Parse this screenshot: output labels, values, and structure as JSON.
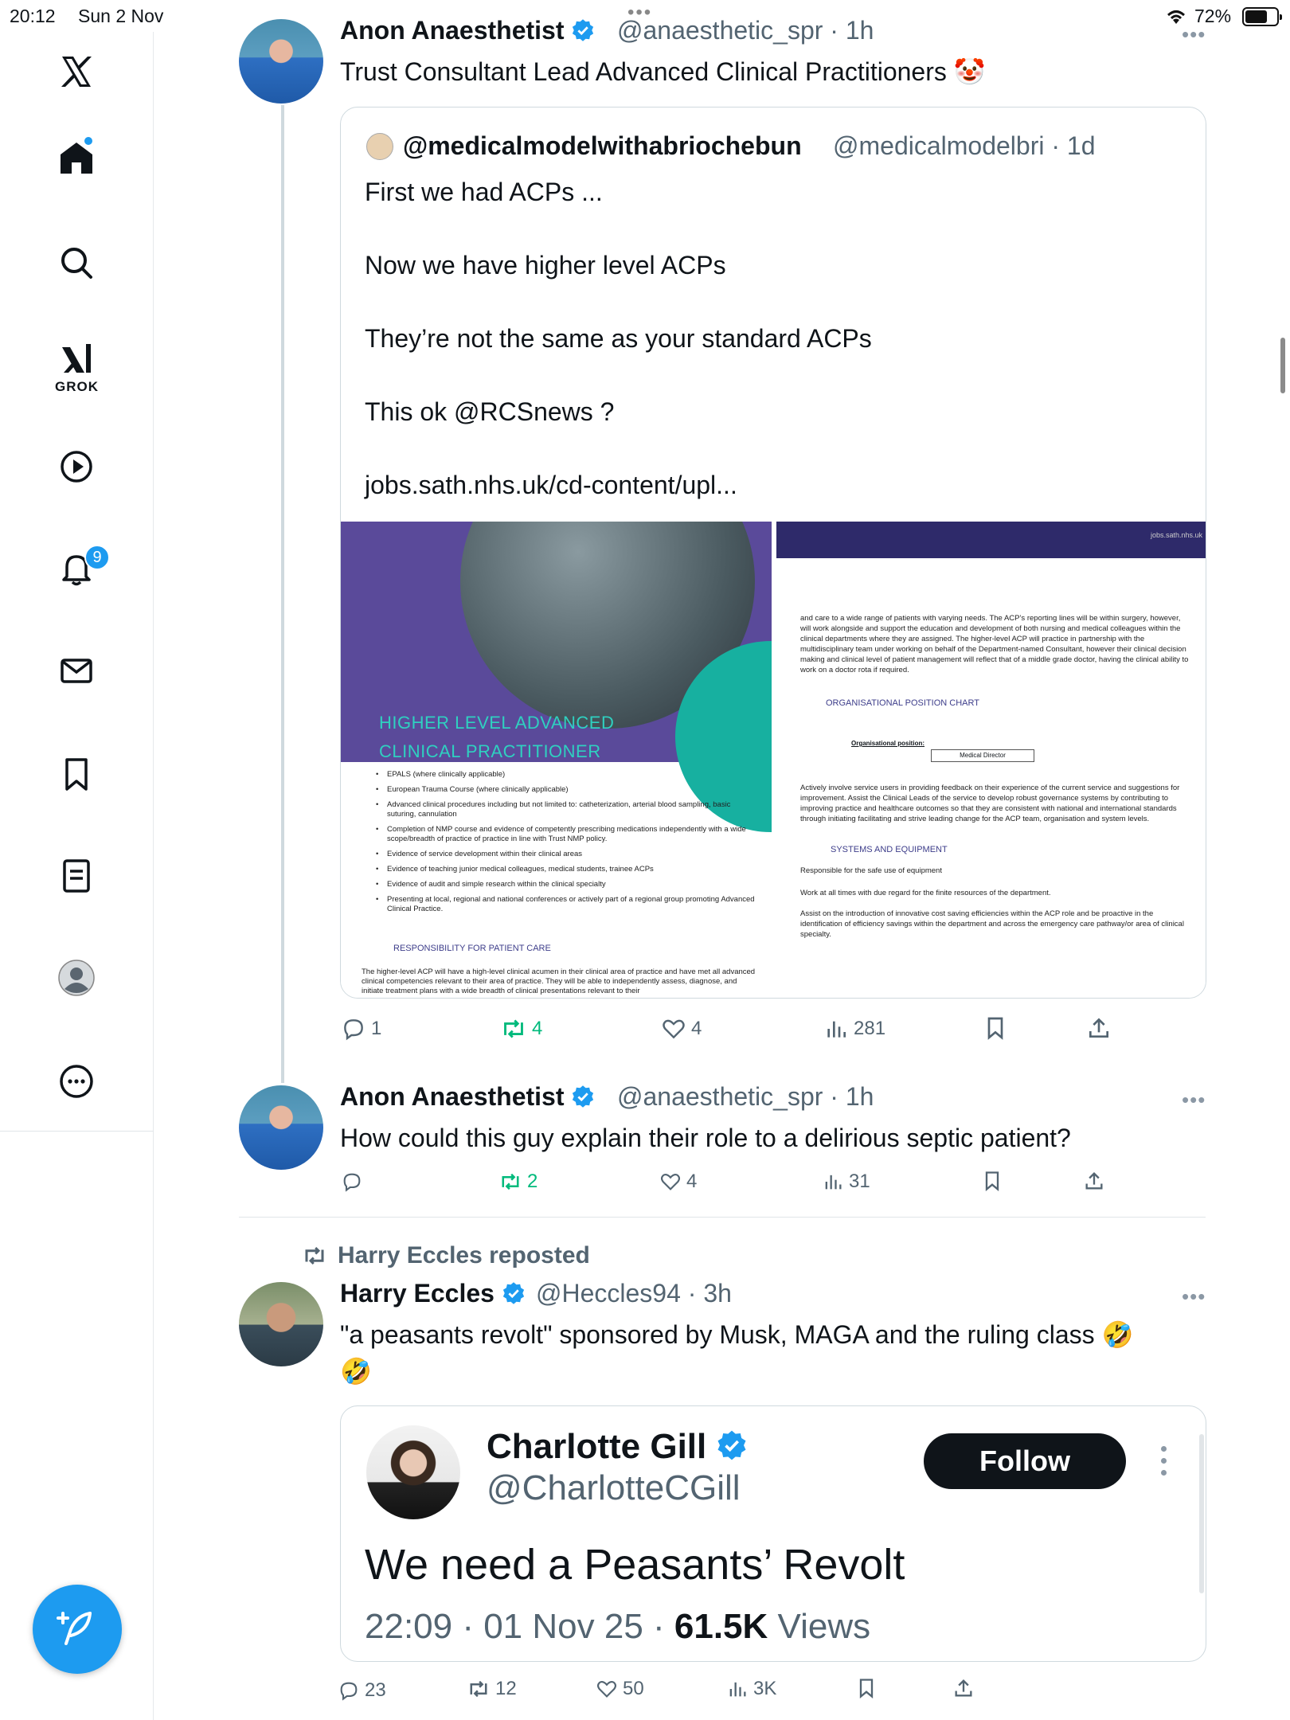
{
  "status_bar": {
    "time": "20:12",
    "date": "Sun 2 Nov",
    "battery": "72%",
    "battery_level": 0.72
  },
  "sidebar": {
    "items": [
      {
        "icon": "x-logo-icon"
      },
      {
        "icon": "home-icon"
      },
      {
        "icon": "search-icon"
      },
      {
        "icon": "grok-icon",
        "label": "GROK"
      },
      {
        "icon": "play-icon"
      },
      {
        "icon": "bell-icon",
        "badge": "9"
      },
      {
        "icon": "mail-icon"
      },
      {
        "icon": "bookmark-icon"
      },
      {
        "icon": "list-icon"
      },
      {
        "icon": "profile-icon"
      },
      {
        "icon": "more-icon"
      }
    ],
    "compose_icon": "compose-icon"
  },
  "colors": {
    "accent": "#1d9bf0",
    "repost_green": "#00ba7c",
    "muted": "#536471"
  },
  "post1": {
    "name": "Anon Anaesthetist",
    "handle": "@anaesthetic_spr",
    "time": "· 1h",
    "text": "Trust Consultant Lead Advanced Clinical Practitioners 🤡",
    "quote": {
      "name": "@medicalmodelwithabriochebun",
      "handle": "@medicalmodelbri · 1d",
      "lines": [
        "First we had ACPs ...",
        "Now we have higher level ACPs",
        "They’re not the same as your standard ACPs",
        "This ok @RCSnews ?",
        "jobs.sath.nhs.uk/cd-content/upl..."
      ],
      "image_left": {
        "title_line1": "HIGHER LEVEL ADVANCED",
        "title_line2": "CLINICAL PRACTITIONER",
        "bullets": [
          "EPALS (where clinically applicable)",
          "European Trauma Course (where clinically applicable)",
          "Advanced clinical procedures including but not limited to: catheterization, arterial blood sampling, basic suturing, cannulation",
          "Completion of NMP course and evidence of competently prescribing medications independently with a wide scope/breadth of practice of practice in line with Trust NMP policy.",
          "Evidence of service development within their clinical areas",
          "Evidence of teaching junior medical colleagues, medical students, trainee ACPs",
          "Evidence of audit and simple research within the clinical specialty",
          "Presenting at local, regional and national conferences or actively part of a regional group promoting Advanced Clinical Practice."
        ],
        "resp_heading": "RESPONSIBILITY FOR PATIENT CARE",
        "resp_body": "The higher-level ACP will have a high-level clinical acumen in their clinical area of practice and have met all advanced clinical competencies relevant to their area of practice. They will be able to independently assess, diagnose, and initiate treatment plans with a wide breadth of clinical presentations relevant to their"
      },
      "image_right": {
        "band_text": "jobs.sath.nhs.uk",
        "para1": "and care to a wide range of patients with varying needs. The ACP’s reporting lines will be within surgery, however, will work alongside and support the education and development of both nursing and medical colleagues within the clinical departments where they are assigned. The higher-level ACP will practice in partnership with the multidisciplinary team under working on behalf of the Department-named Consultant, however their clinical decision making and clinical level of patient management will reflect that of a middle grade doctor, having the clinical ability to work on a doctor rota if required.",
        "heading1": "ORGANISATIONAL POSITION CHART",
        "org_label": "Organisational position:",
        "org_box": "Medical Director",
        "para2": "Actively involve service users in providing feedback on their experience of the current service and suggestions for improvement. Assist the Clinical Leads of the service to develop robust governance systems by contributing to improving practice and healthcare outcomes so that they are consistent with national and international standards through initiating facilitating and strive leading change for the ACP team, organisation and system levels.",
        "heading2": "SYSTEMS AND EQUIPMENT",
        "para3": "Responsible for the safe use of equipment",
        "para4": "Work at all times with due regard for the finite resources of the department.",
        "para5": "Assist on the introduction of innovative cost saving efficiencies within the ACP role and be proactive in the identification of efficiency savings within the department and across the emergency care pathway/or area of clinical specialty."
      }
    },
    "stats": {
      "replies": "1",
      "reposts": "4",
      "likes": "4",
      "views": "281"
    }
  },
  "post2": {
    "name": "Anon Anaesthetist",
    "handle": "@anaesthetic_spr",
    "time": "· 1h",
    "text": "How could this guy explain their role to a delirious septic patient?",
    "stats": {
      "replies": "",
      "reposts": "2",
      "likes": "4",
      "views": "31"
    }
  },
  "post3": {
    "repost_label": "Harry Eccles reposted",
    "name": "Harry Eccles",
    "handle": "@Heccles94",
    "time": "· 3h",
    "text_line1": "\"a peasants revolt\" sponsored by Musk, MAGA and the ruling class 🤣",
    "text_line2": "🤣",
    "embed": {
      "name": "Charlotte Gill",
      "handle": "@CharlotteCGill",
      "follow_label": "Follow",
      "text": "We need a Peasants’ Revolt",
      "time": "22:09 · 01 Nov 25 · ",
      "views_count": "61.5K",
      "views_label": " Views"
    },
    "stats": {
      "replies": "23",
      "reposts": "12",
      "likes": "50",
      "views": "3K"
    }
  }
}
